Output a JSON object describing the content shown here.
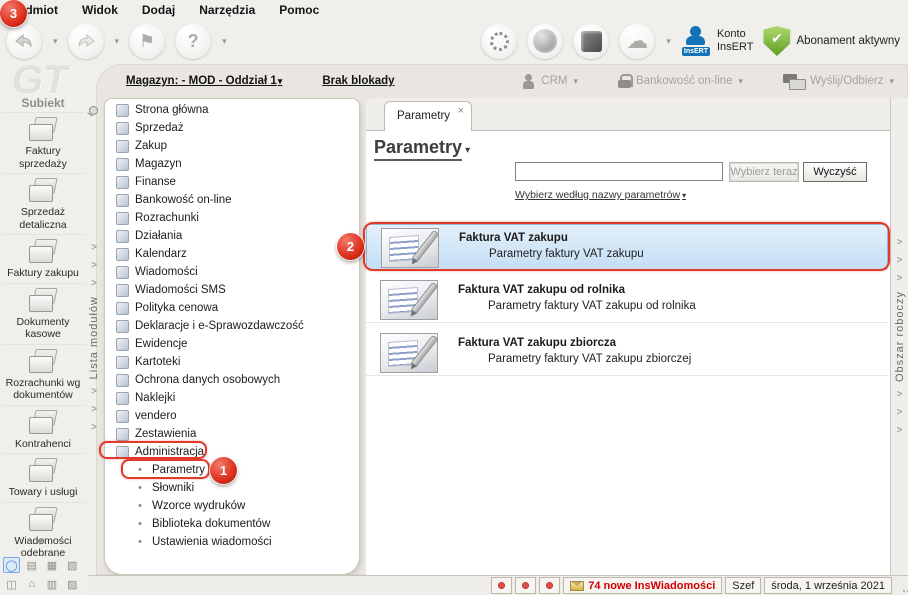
{
  "window": {
    "app_name": "Subiekt",
    "logo_watermark": "GT"
  },
  "menubar": {
    "items": [
      "Podmiot",
      "Widok",
      "Dodaj",
      "Narzędzia",
      "Pomoc"
    ]
  },
  "toolbar": {
    "konto": {
      "line1": "Konto",
      "line2": "InsERT",
      "badge_text": "InsERT"
    },
    "abonament": {
      "label": "Abonament aktywny"
    }
  },
  "context_bar": {
    "magazyn_label": "Magazyn: - MOD - Oddział 1",
    "lock_label": "Brak blokady",
    "crm_label": "CRM",
    "banking_label": "Bankowość on-line",
    "send_receive_label": "Wyślij/Odbierz"
  },
  "module_strip": {
    "label": "Lista modułów"
  },
  "workspace_strip": {
    "label": "Obszar roboczy"
  },
  "sidebar": {
    "items": [
      {
        "label": "Faktury sprzedaży",
        "icon": "sales-invoices-icon"
      },
      {
        "label": "Sprzedaż detaliczna",
        "icon": "retail-sales-icon"
      },
      {
        "label": "Faktury zakupu",
        "icon": "purchase-invoices-icon"
      },
      {
        "label": "Dokumenty kasowe",
        "icon": "cash-documents-icon"
      },
      {
        "label": "Rozrachunki wg dokumentów",
        "icon": "settlements-by-documents-icon"
      },
      {
        "label": "Kontrahenci",
        "icon": "contractors-icon"
      },
      {
        "label": "Towary i usługi",
        "icon": "goods-and-services-icon"
      },
      {
        "label": "Wiadomości odebrane",
        "icon": "inbox-messages-icon"
      }
    ],
    "mini_icons": [
      {
        "name": "circle-module-icon",
        "glyph": "◯",
        "selected": true
      },
      {
        "name": "coins-module-icon",
        "glyph": "▤",
        "selected": false
      },
      {
        "name": "basket-module-icon",
        "glyph": "▦",
        "selected": false
      },
      {
        "name": "box-module-icon",
        "glyph": "▧",
        "selected": false
      },
      {
        "name": "clock-module-icon",
        "glyph": "◫",
        "selected": false
      },
      {
        "name": "home-module-icon",
        "glyph": "⌂",
        "selected": false
      },
      {
        "name": "packages-module-icon",
        "glyph": "▥",
        "selected": false
      },
      {
        "name": "wallet-module-icon",
        "glyph": "▨",
        "selected": false
      }
    ]
  },
  "tree": {
    "items": [
      {
        "label": "Strona główna",
        "icon": "home-icon",
        "child": false
      },
      {
        "label": "Sprzedaż",
        "icon": "sales-icon",
        "child": false
      },
      {
        "label": "Zakup",
        "icon": "purchase-icon",
        "child": false
      },
      {
        "label": "Magazyn",
        "icon": "warehouse-icon",
        "child": false
      },
      {
        "label": "Finanse",
        "icon": "finance-icon",
        "child": false
      },
      {
        "label": "Bankowość on-line",
        "icon": "online-banking-icon",
        "child": false
      },
      {
        "label": "Rozrachunki",
        "icon": "settlements-icon",
        "child": false
      },
      {
        "label": "Działania",
        "icon": "actions-icon",
        "child": false
      },
      {
        "label": "Kalendarz",
        "icon": "calendar-icon",
        "child": false
      },
      {
        "label": "Wiadomości",
        "icon": "messages-icon",
        "child": false
      },
      {
        "label": "Wiadomości SMS",
        "icon": "sms-icon",
        "child": false
      },
      {
        "label": "Polityka cenowa",
        "icon": "pricing-policy-icon",
        "child": false
      },
      {
        "label": "Deklaracje i e-Sprawozdawczość",
        "icon": "declarations-icon",
        "child": false
      },
      {
        "label": "Ewidencje",
        "icon": "records-icon",
        "child": false
      },
      {
        "label": "Kartoteki",
        "icon": "card-files-icon",
        "child": false
      },
      {
        "label": "Ochrona danych osobowych",
        "icon": "data-protection-icon",
        "child": false
      },
      {
        "label": "Naklejki",
        "icon": "labels-icon",
        "child": false
      },
      {
        "label": "vendero",
        "icon": "vendero-gear-icon",
        "child": false
      },
      {
        "label": "Zestawienia",
        "icon": "reports-icon",
        "child": false
      },
      {
        "label": "Administracja",
        "icon": "administration-icon",
        "child": false
      },
      {
        "label": "Parametry",
        "icon": "bullet-icon",
        "child": true
      },
      {
        "label": "Słowniki",
        "icon": "bullet-icon",
        "child": true
      },
      {
        "label": "Wzorce wydruków",
        "icon": "bullet-icon",
        "child": true
      },
      {
        "label": "Biblioteka dokumentów",
        "icon": "bullet-icon",
        "child": true
      },
      {
        "label": "Ustawienia wiadomości",
        "icon": "bullet-icon",
        "child": true
      }
    ]
  },
  "main": {
    "tab": {
      "label": "Parametry"
    },
    "title": "Parametry",
    "search": {
      "value": "",
      "select_button": "Wybierz teraz",
      "clear_button": "Wyczyść",
      "filter_link": "Wybierz według nazwy parametrów"
    },
    "list": [
      {
        "title": "Faktura VAT zakupu",
        "subtitle": "Parametry faktury VAT zakupu",
        "selected": true
      },
      {
        "title": "Faktura VAT zakupu od rolnika",
        "subtitle": "Parametry faktury VAT zakupu od rolnika",
        "selected": false
      },
      {
        "title": "Faktura VAT zakupu zbiorcza",
        "subtitle": "Parametry faktury VAT zakupu zbiorczej",
        "selected": false
      }
    ]
  },
  "statusbar": {
    "dots": [
      "",
      "",
      ""
    ],
    "messages_label": "74 nowe InsWiadomości",
    "user_label": "Szef",
    "date_label": "środa, 1 września 2021"
  },
  "annotations": {
    "circles": [
      {
        "n": "1"
      },
      {
        "n": "2"
      },
      {
        "n": "3"
      }
    ]
  },
  "icons": {
    "caret_down": "▾",
    "close_glyph": "×",
    "chevron": ">",
    "bullet": "•",
    "check": "✔",
    "flag": "⚑",
    "cloud": "☁",
    "help": "?",
    "more_down": "▼"
  },
  "colors": {
    "annotation_red": "#df3a2a",
    "selected_row_blue": "#c4def5",
    "status_red": "#d40000",
    "insert_blue": "#1273b8",
    "shield_green": "#5f9d21"
  }
}
